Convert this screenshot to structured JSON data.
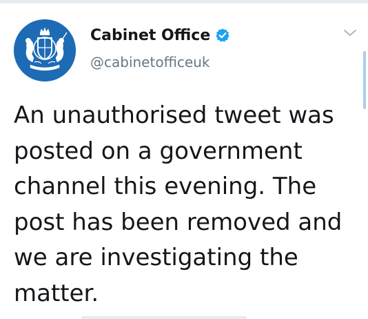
{
  "tweet": {
    "display_name": "Cabinet Office",
    "handle": "@cabinetofficeuk",
    "verified": true,
    "avatar_icon": "royal-coat-of-arms-logo",
    "text_lines": [
      "An unauthorised tweet was",
      "posted on a government",
      "channel this evening. The",
      "post has been removed and",
      "we are investigating the",
      "matter."
    ]
  },
  "colors": {
    "avatar_background": "#1d6bb5",
    "verified_badge": "#1da1f2",
    "handle_text": "#657786",
    "scrollbar": "#a8cdee"
  }
}
